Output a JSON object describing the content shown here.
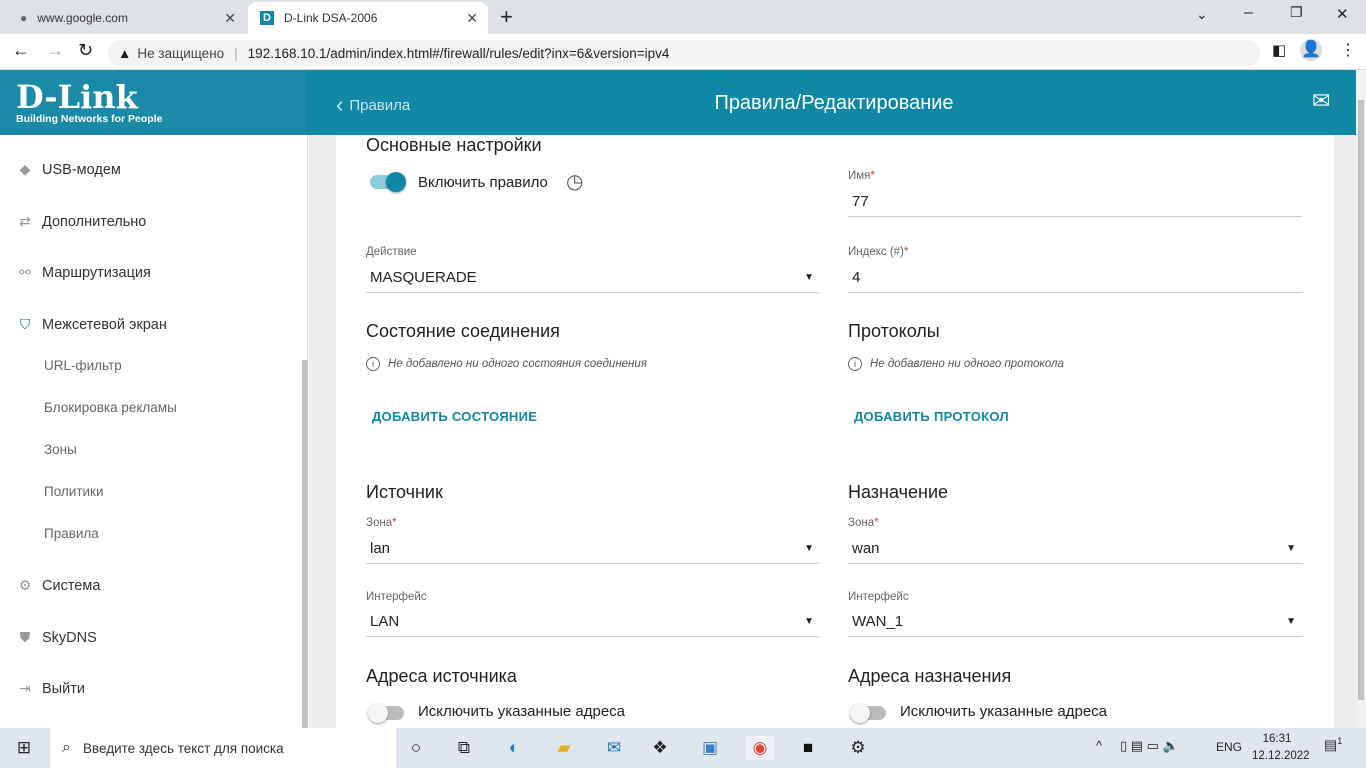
{
  "browser": {
    "tabs": [
      {
        "title": "www.google.com",
        "icon": "globe-icon"
      },
      {
        "title": "D-Link DSA-2006",
        "icon": "dlink-favicon"
      }
    ],
    "security": "Не защищено",
    "url": "192.168.10.1/admin/index.html#/firewall/rules/edit?inx=6&version=ipv4"
  },
  "logo": {
    "brand": "D-Link",
    "tagline": "Building Networks for People"
  },
  "header": {
    "back": "Правила",
    "title": "Правила/Редактирование"
  },
  "sidebar": {
    "items": [
      {
        "label": "USB-модем",
        "icon": "usb-icon"
      },
      {
        "label": "Дополнительно",
        "icon": "arrows-icon"
      },
      {
        "label": "Маршрутизация",
        "icon": "routing-icon"
      },
      {
        "label": "Межсетевой экран",
        "icon": "shield-icon"
      },
      {
        "label": "Система",
        "icon": "gear-icon"
      },
      {
        "label": "SkyDNS",
        "icon": "skydns-shield-icon"
      },
      {
        "label": "Выйти",
        "icon": "logout-icon"
      }
    ],
    "subitems": [
      "URL-фильтр",
      "Блокировка рекламы",
      "Зоны",
      "Политики",
      "Правила"
    ]
  },
  "form": {
    "main_title": "Основные настройки",
    "enable_label": "Включить правило",
    "enabled": true,
    "name_label": "Имя",
    "name_value": "77",
    "action_label": "Действие",
    "action_value": "MASQUERADE",
    "index_label": "Индекс (#)",
    "index_value": "4",
    "conn_title": "Состояние соединения",
    "conn_info": "Не добавлено ни одного состояния соединения",
    "conn_btn": "ДОБАВИТЬ СОСТОЯНИЕ",
    "proto_title": "Протоколы",
    "proto_info": "Не добавлено ни одного протокола",
    "proto_btn": "ДОБАВИТЬ ПРОТОКОЛ",
    "src_title": "Источник",
    "src_zone_label": "Зона",
    "src_zone": "lan",
    "src_if_label": "Интерфейс",
    "src_if": "LAN",
    "dst_title": "Назначение",
    "dst_zone_label": "Зона",
    "dst_zone": "wan",
    "dst_if_label": "Интерфейс",
    "dst_if": "WAN_1",
    "src_addr_title": "Адреса источника",
    "src_exclude": "Исключить указанные адреса",
    "dst_addr_title": "Адреса назначения",
    "dst_exclude": "Исключить указанные адреса",
    "required": "*"
  },
  "taskbar": {
    "search_placeholder": "Введите здесь текст для поиска",
    "lang": "ENG",
    "time": "16:31",
    "date": "12.12.2022",
    "notif": "1"
  },
  "colors": {
    "accent": "#0f87a5"
  }
}
